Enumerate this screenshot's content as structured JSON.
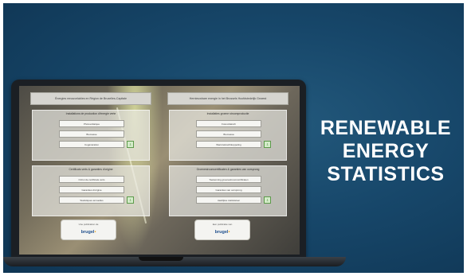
{
  "screen": {
    "header_left": "Énergies renouvelables en Région de Bruxelles-Capitale",
    "header_right": "Hernieuwbare energie in het Brussels Hoofdstedelijk Gewest",
    "panels": [
      {
        "title": "Installations de production d'énergie verte",
        "items": [
          "Photovoltaïque",
          "Biomasse",
          "Cogénération"
        ],
        "download": true
      },
      {
        "title": "Installaties groene stroomproductie",
        "items": [
          "Fotovoltaïsch",
          "Biomassa",
          "Warmtekrachtkoppeling"
        ],
        "download": true
      },
      {
        "title": "Certificats verts & garanties d'origine",
        "items": [
          "Octroi de certificats verts",
          "Garanties d'origine",
          "Statistiques annuelles"
        ],
        "download": true
      },
      {
        "title": "Groenestroomcertificaten & garanties van oorsprong",
        "items": [
          "Toekenning groenestroomcertificaten",
          "Garanties van oorsprong",
          "Jaarlijkse statistieken"
        ],
        "download": true
      }
    ],
    "brand_cards": [
      {
        "caption": "Une publication de",
        "logo_main": "brugel",
        "logo_accent": "•"
      },
      {
        "caption": "Een publicatie van",
        "logo_main": "brugel",
        "logo_accent": "•"
      }
    ]
  },
  "headline": {
    "line1": "RENEWABLE",
    "line2": "ENERGY",
    "line3": "STATISTICS"
  },
  "colors": {
    "background": "#17476a",
    "headline": "#ffffff",
    "brand": "#1f4f8c",
    "download_green": "#5c9a4a"
  }
}
